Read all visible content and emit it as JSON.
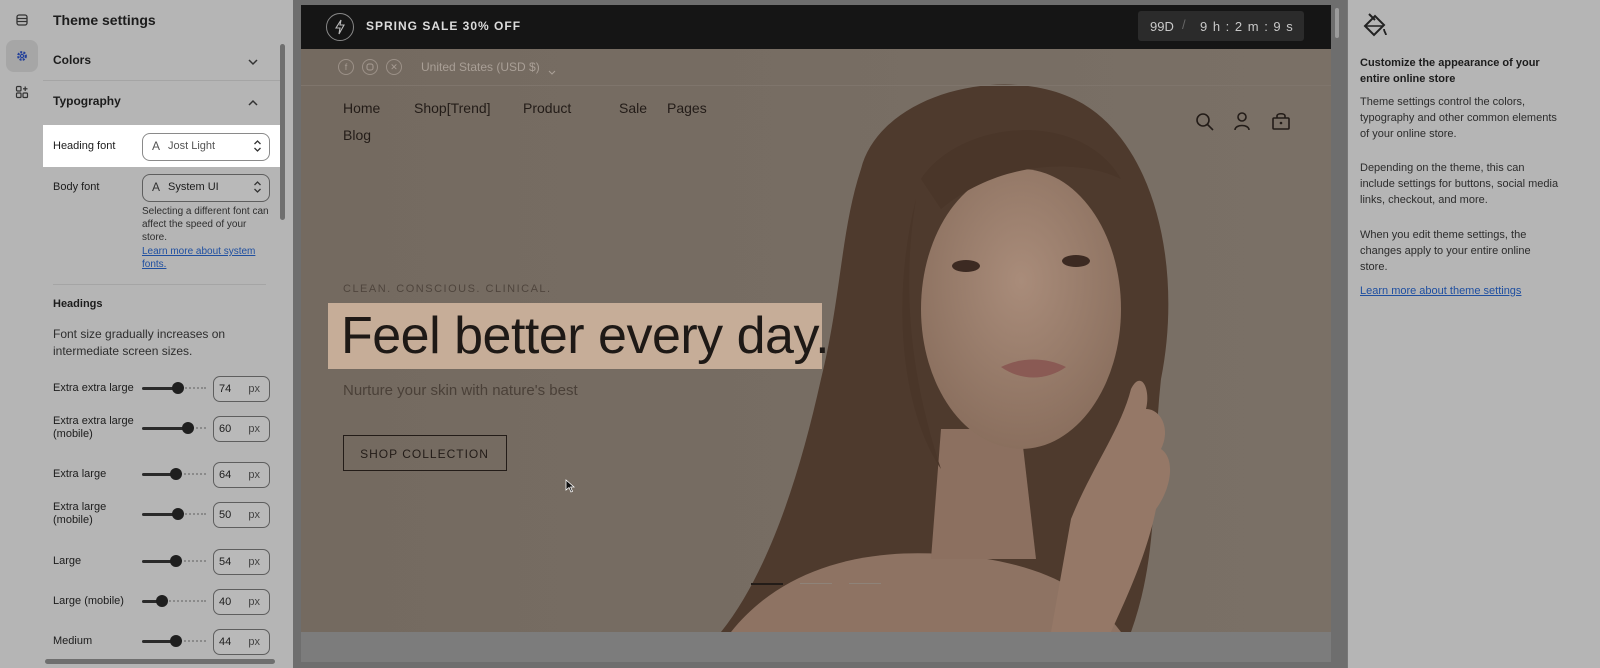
{
  "panel": {
    "title": "Theme settings",
    "colors_label": "Colors",
    "typography_label": "Typography",
    "heading_font_label": "Heading font",
    "heading_font_value": "Jost Light",
    "body_font_label": "Body font",
    "body_font_value": "System UI",
    "font_help_line1": "Selecting a different font can",
    "font_help_line2": "affect the speed of your",
    "font_help_line3": "store.",
    "font_link_line1": "Learn more about system",
    "font_link_line2": "fonts.",
    "headings_title": "Headings",
    "headings_desc_line1": "Font size gradually increases on",
    "headings_desc_line2": "intermediate screen sizes.",
    "unit": "px",
    "sizes": [
      {
        "label": "Extra extra large",
        "value": "74",
        "fraction": 0.56
      },
      {
        "label1": "Extra extra large",
        "label2": "(mobile)",
        "value": "60",
        "fraction": 0.72
      },
      {
        "label": "Extra large",
        "value": "64",
        "fraction": 0.53
      },
      {
        "label1": "Extra large",
        "label2": "(mobile)",
        "value": "50",
        "fraction": 0.56
      },
      {
        "label": "Large",
        "value": "54",
        "fraction": 0.53
      },
      {
        "label": "Large (mobile)",
        "value": "40",
        "fraction": 0.31
      },
      {
        "label": "Medium",
        "value": "44",
        "fraction": 0.53
      }
    ]
  },
  "store": {
    "promo": "SPRING SALE 30% OFF",
    "countdown_days": "99D",
    "countdown_time": "9 h : 2 m : 9 s",
    "currency": "United States (USD $)",
    "nav": [
      "Home",
      "Shop[Trend]",
      "Product",
      "Sale",
      "Pages",
      "Blog"
    ],
    "eyebrow": "CLEAN. CONSCIOUS. CLINICAL.",
    "headline": "Feel better every day.",
    "subheadline": "Nurture your skin with nature's best",
    "cta": "SHOP COLLECTION"
  },
  "info": {
    "title_line1": "Customize the appearance of your",
    "title_line2": "entire online store",
    "p1": "Theme settings control the colors, typography and other common elements of your online store.",
    "p2": "Depending on the theme, this can include settings for buttons, social media links, checkout, and more.",
    "p3": "When you edit theme settings, the changes apply to your entire online store.",
    "link": "Learn more about theme settings"
  },
  "icons": {
    "rail": [
      "sections-icon",
      "theme-settings-icon",
      "apps-icon"
    ],
    "social": [
      "facebook-icon",
      "instagram-icon",
      "x-icon"
    ],
    "header": [
      "search-icon",
      "account-icon",
      "cart-icon"
    ],
    "info": "paint-bucket-icon"
  },
  "colors": {
    "overlay_bg": "#b5b5b5",
    "link": "#1f4fa0",
    "highlight": "#c6ad98"
  }
}
